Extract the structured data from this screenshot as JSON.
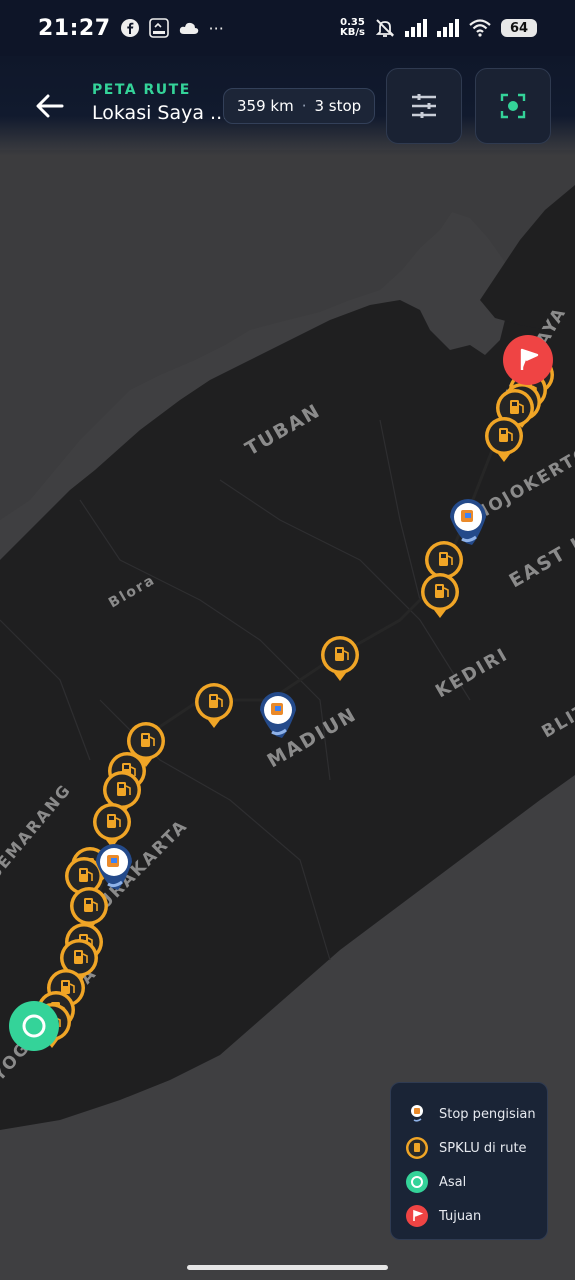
{
  "status_bar": {
    "time": "21:27",
    "net_speed_value": "0.35",
    "net_speed_unit": "KB/s",
    "battery": "64",
    "icons": [
      "facebook-icon",
      "imoo-icon",
      "cloud-icon",
      "more-dots-icon",
      "mute-bell-icon",
      "signal-icon",
      "signal-icon",
      "wifi-icon",
      "battery-icon"
    ]
  },
  "header": {
    "subtitle": "PETA RUTE",
    "title": "Lokasi Saya ...",
    "distance": "359 km",
    "separator": "·",
    "stops": "3 stop",
    "back_icon": "arrow-left-icon",
    "filter_icon": "sliders-icon",
    "recenter_icon": "focus-target-icon",
    "accent_color": "#34d399"
  },
  "map": {
    "labels": [
      "TUBAN",
      "Blora",
      "MADIUN",
      "KEDIRI",
      "EAST J",
      "BLIT",
      "MOJOKERTO",
      "SURABAYA",
      "YOGYAKARTA",
      "SURAKARTA",
      "SEMARANG"
    ]
  },
  "legend": {
    "items": [
      {
        "label": "Stop pengisian",
        "icon": "charging-stop-pin-icon"
      },
      {
        "label": "SPKLU di rute",
        "icon": "spklu-station-icon"
      },
      {
        "label": "Asal",
        "icon": "origin-icon"
      },
      {
        "label": "Tujuan",
        "icon": "destination-flag-icon"
      }
    ]
  },
  "colors": {
    "spklu": "#f0a526",
    "origin": "#34d399",
    "destination": "#ef4444",
    "stop": "#2563a6"
  }
}
